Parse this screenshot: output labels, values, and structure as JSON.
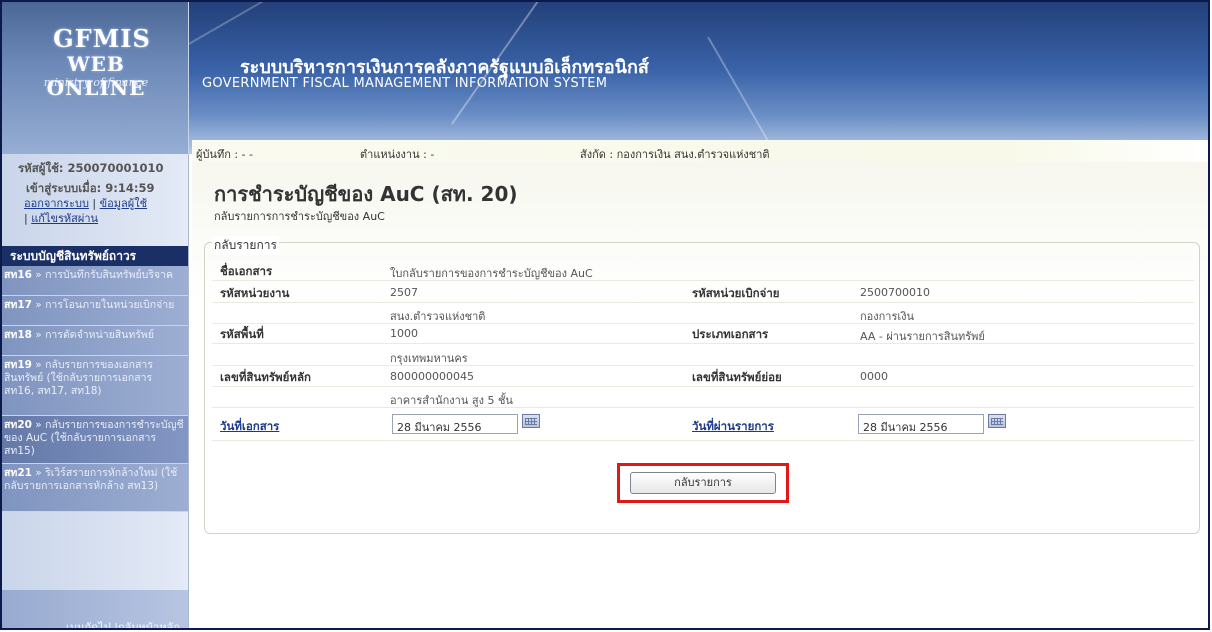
{
  "header": {
    "logo_title": "GFMIS",
    "logo_sub": "WEB ONLINE",
    "logo_ministry": "ministry of finance",
    "system_title_th": "ระบบบริหารการเงินการคลังภาครัฐแบบอิเล็กทรอนิกส์",
    "system_title_en": "GOVERNMENT FISCAL MANAGEMENT INFORMATION SYSTEM"
  },
  "sidebar": {
    "user_id": "รหัสผู้ใช้: 250070001010",
    "login_time": "เข้าสู่ระบบเมื่อ: 9:14:59",
    "link_logout": "ออกจากระบบ",
    "link_userinfo": "ข้อมูลผู้ใช้",
    "link_changepw": "แก้ไขรหัสผ่าน",
    "menu_header": "ระบบบัญชีสินทรัพย์ถาวร",
    "items": [
      {
        "code": "สท16",
        "label": "การบันทึกรับสินทรัพย์บริจาค"
      },
      {
        "code": "สท17",
        "label": "การโอนภายในหน่วยเบิกจ่าย"
      },
      {
        "code": "สท18",
        "label": "การตัดจำหน่ายสินทรัพย์"
      },
      {
        "code": "สท19",
        "label": "กลับรายการของเอกสารสินทรัพย์ (ใช้กลับรายการเอกสาร สท16, สท17, สท18)"
      },
      {
        "code": "สท20",
        "label": "กลับรายการของการชำระบัญชีของ AuC (ใช้กลับรายการเอกสาร สท15)"
      },
      {
        "code": "สท21",
        "label": "ริเวิร์สรายการหักล้างใหม่ (ใช้กลับรายการเอกสารหักล้าง สท13)"
      }
    ],
    "footer": "เมนูถัดไป |กลับหน้าหลัก"
  },
  "topbar": {
    "recorder": "ผู้บันทึก : - -",
    "position": "ตำแหน่งงาน : -",
    "affiliation": "สังกัด : กองการเงิน สนง.ตำรวจแห่งชาติ"
  },
  "main": {
    "title": "การชำระบัญชีของ AuC (สท. 20)",
    "subtitle": "กลับรายการการชำระบัญชีของ AuC",
    "legend": "กลับรายการ",
    "fields": {
      "doc_name_label": "ชื่อเอกสาร",
      "doc_name_value": "ใบกลับรายการของการชำระบัญชีของ AuC",
      "agency_code_label": "รหัสหน่วยงาน",
      "agency_code_value": "2507",
      "agency_name": "สนง.ตำรวจแห่งชาติ",
      "disb_unit_label": "รหัสหน่วยเบิกจ่าย",
      "disb_unit_value": "2500700010",
      "disb_unit_name": "กองการเงิน",
      "area_code_label": "รหัสพื้นที่",
      "area_code_value": "1000",
      "area_name": "กรุงเทพมหานคร",
      "doc_type_label": "ประเภทเอกสาร",
      "doc_type_value": "AA - ผ่านรายการสินทรัพย์",
      "main_asset_label": "เลขที่สินทรัพย์หลัก",
      "main_asset_value": "800000000045",
      "asset_desc": "อาคารสำนักงาน สูง 5 ชั้น",
      "sub_asset_label": "เลขที่สินทรัพย์ย่อย",
      "sub_asset_value": "0000",
      "doc_date_label": "วันที่เอกสาร",
      "doc_date_value": "28 มีนาคม 2556",
      "post_date_label": "วันที่ผ่านรายการ",
      "post_date_value": "28 มีนาคม 2556"
    },
    "back_button": "กลับรายการ"
  }
}
